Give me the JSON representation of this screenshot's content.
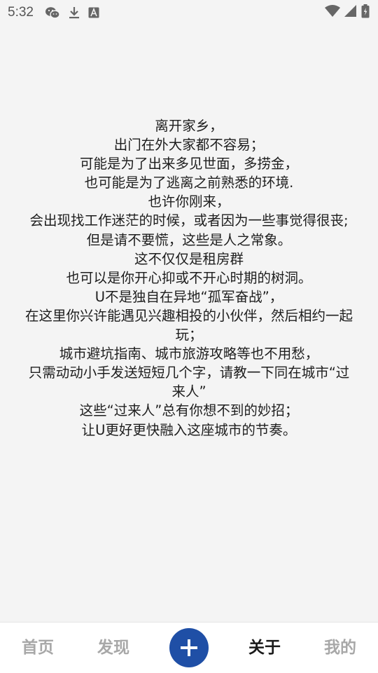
{
  "status_bar": {
    "time": "5:32",
    "left_icons": [
      "wechat-icon",
      "download-icon",
      "text-a-icon"
    ],
    "right_icons": [
      "wifi-icon",
      "signal-icon",
      "battery-icon"
    ]
  },
  "about": {
    "lines": [
      "离开家乡，",
      "出门在外大家都不容易；",
      "可能是为了出来多见世面，多捞金，",
      "也可能是为了逃离之前熟悉的环境.",
      "也许你刚来，",
      "会出现找工作迷茫的时候，或者因为一些事觉得很丧;",
      "但是请不要慌，这些是人之常象。",
      "这不仅仅是租房群",
      "也可以是你开心抑或不开心时期的树洞。",
      "U不是独自在异地“孤军奋战”，",
      "在这里你兴许能遇见兴趣相投的小伙伴，然后相约一起",
      "玩；",
      "城市避坑指南、城市旅游攻略等也不用愁，",
      "只需动动小手发送短短几个字，请教一下同在城市“过",
      "来人”",
      "这些“过来人”总有你想不到的妙招；",
      "让U更好更快融入这座城市的节奏。"
    ]
  },
  "bottom_nav": {
    "home_label": "首页",
    "discover_label": "发现",
    "add_icon": "plus-icon",
    "about_label": "关于",
    "mine_label": "我的",
    "active_tab": "关于",
    "accent_color": "#1f4fa6"
  }
}
